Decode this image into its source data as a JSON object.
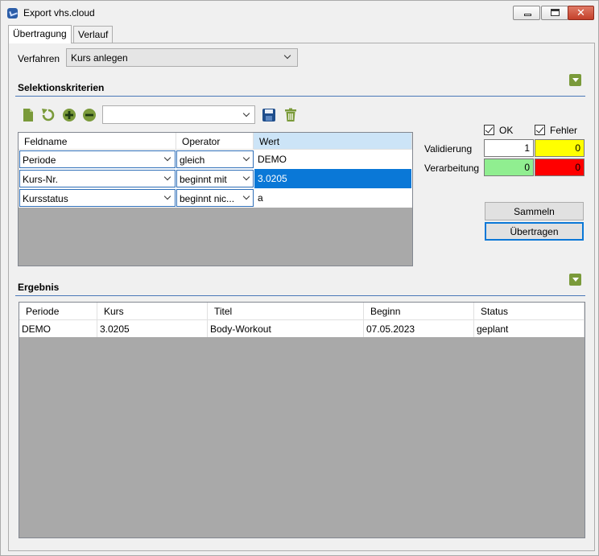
{
  "window": {
    "title": "Export vhs.cloud",
    "close_glyph": "✕"
  },
  "tabs": [
    {
      "label": "Übertragung",
      "active": true
    },
    {
      "label": "Verlauf",
      "active": false
    }
  ],
  "verfahren": {
    "label": "Verfahren",
    "selected": "Kurs anlegen"
  },
  "selektionskriterien": {
    "title": "Selektionskriterien",
    "toolbar": {
      "icons": [
        "new-document-icon",
        "undo-icon",
        "add-icon",
        "remove-icon",
        "save-icon",
        "delete-icon"
      ],
      "filter_combo_value": ""
    },
    "grid": {
      "columns": [
        "Feldname",
        "Operator",
        "Wert"
      ],
      "rows": [
        {
          "feldname": "Periode",
          "operator": "gleich",
          "wert": "DEMO",
          "selected": false
        },
        {
          "feldname": "Kurs-Nr.",
          "operator": "beginnt mit",
          "wert": "3.0205",
          "selected": true
        },
        {
          "feldname": "Kursstatus",
          "operator": "beginnt nic...",
          "wert": "a",
          "selected": false
        }
      ]
    }
  },
  "status": {
    "ok_label": "OK",
    "fehler_label": "Fehler",
    "ok_checked": true,
    "fehler_checked": true,
    "validierung_label": "Validierung",
    "verarbeitung_label": "Verarbeitung",
    "validierung_ok": "1",
    "validierung_fehler": "0",
    "verarbeitung_ok": "0",
    "verarbeitung_fehler": "0",
    "colors": {
      "validierung_fehler_bg": "#ffff00",
      "verarbeitung_ok_bg": "#90ee90",
      "verarbeitung_fehler_bg": "#ff0000"
    }
  },
  "buttons": {
    "sammeln": "Sammeln",
    "uebertragen": "Übertragen"
  },
  "ergebnis": {
    "title": "Ergebnis",
    "columns": [
      "Periode",
      "Kurs",
      "Titel",
      "Beginn",
      "Status"
    ],
    "rows": [
      [
        "DEMO",
        "3.0205",
        "Body-Workout",
        "07.05.2023",
        "geplant"
      ]
    ]
  }
}
